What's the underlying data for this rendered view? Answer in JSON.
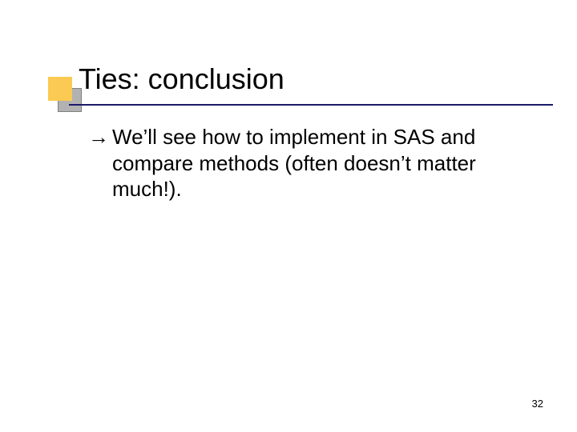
{
  "slide": {
    "title": "Ties: conclusion",
    "bullets": [
      {
        "marker": "→",
        "text": "We’ll see how to implement in SAS and compare methods (often doesn’t matter much!)."
      }
    ],
    "page_number": "32"
  },
  "colors": {
    "accent_orange": "#faca52",
    "accent_gray": "#b2b2b2",
    "underline": "#1a1a6a"
  }
}
